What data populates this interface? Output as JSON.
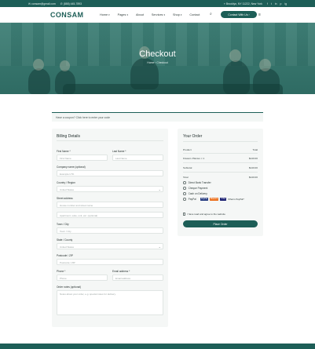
{
  "topbar": {
    "email": "consam@gmail.com",
    "phone": "(888) 445-7893",
    "address": "Brooklyn, NY 11222, New York",
    "social": [
      "f",
      "t",
      "in",
      "p",
      "ig"
    ]
  },
  "header": {
    "logo": "CONSAM",
    "nav": [
      "Home",
      "Pages",
      "About",
      "Services",
      "Shop",
      "Contact"
    ],
    "cta": "Contact With Us"
  },
  "hero": {
    "title": "Checkout",
    "breadcrumb_home": "Home",
    "breadcrumb_sep": "›",
    "breadcrumb_current": "Checkout"
  },
  "coupon": {
    "text": "Have a coupon? Click here to enter your code"
  },
  "billing": {
    "title": "Billing Details",
    "first_name_label": "First Name *",
    "first_name_ph": "First Name",
    "last_name_label": "Last Name *",
    "last_name_ph": "Last Name",
    "company_label": "Company name (optional)",
    "company_ph": "Example LTD.",
    "country_label": "Country / Region",
    "country_value": "United States",
    "street_label": "Street address",
    "street_ph": "House number and street name",
    "street2_ph": "Apartment, suite, unit, etc. (optional)",
    "town_label": "Town / City",
    "town_ph": "Town / City",
    "state_label": "State / County",
    "state_value": "United States",
    "postcode_label": "Postcode / ZIP",
    "postcode_ph": "Postcode / ZIP",
    "phone_label": "Phone *",
    "phone_ph": "Phone",
    "email_label": "Email address *",
    "email_ph": "Email address",
    "notes_label": "Order notes (optional)",
    "notes_ph": "Notes about your order, e.g. special notes for delivery."
  },
  "order": {
    "title": "Your Order",
    "col_product": "Product",
    "col_total": "Total",
    "item_name": "Flowers Plantex × 1",
    "item_total": "$140.00",
    "subtotal_label": "Subtotal",
    "subtotal_value": "$140.00",
    "total_label": "Total",
    "total_value": "$140.00",
    "payments": [
      "Direct Bank Transfer",
      "Cheque Payment",
      "Cash on Delivery",
      "PayPal"
    ],
    "cards": [
      "PayPal",
      "Maestro",
      "VISA",
      "What is PayPal?"
    ],
    "terms": "I have read and agree to the website",
    "place_order": "Place Order"
  },
  "colors": {
    "brand": "#1d5e57",
    "panel": "#f5f7f6"
  }
}
